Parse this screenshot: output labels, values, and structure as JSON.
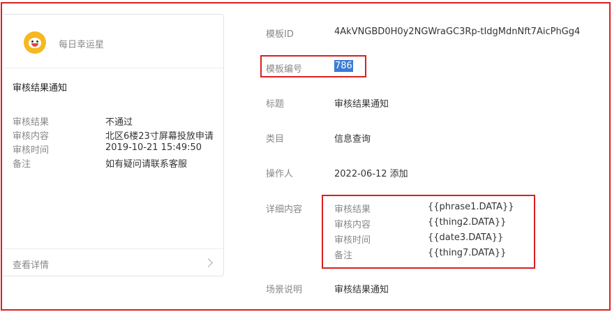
{
  "preview": {
    "account_name": "每日幸运星",
    "title": "审核结果通知",
    "rows": [
      {
        "key": "审核结果",
        "value": "不通过"
      },
      {
        "key": "审核内容",
        "value": "北区6楼23寸屏幕投放申请"
      },
      {
        "key": "审核时间",
        "value": "2019-10-21 15:49:50"
      },
      {
        "key": "备注",
        "value": "如有疑问请联系客服"
      }
    ],
    "view_detail": "查看详情"
  },
  "detail": {
    "template_id_label": "模板ID",
    "template_id": "4AkVNGBD0H0y2NGWraGC3Rp-tIdgMdnNft7AicPhGg4",
    "template_number_label": "模板编号",
    "template_number": "786",
    "title_label": "标题",
    "title": "审核结果通知",
    "category_label": "类目",
    "category": "信息查询",
    "operator_label": "操作人",
    "operator": "2022-06-12 添加",
    "content_label": "详细内容",
    "content_rows": [
      {
        "key": "审核结果",
        "value": "{{phrase1.DATA}}"
      },
      {
        "key": "审核内容",
        "value": "{{thing2.DATA}}"
      },
      {
        "key": "审核时间",
        "value": "{{date3.DATA}}"
      },
      {
        "key": "备注",
        "value": "{{thing7.DATA}}"
      }
    ],
    "scene_label": "场景说明",
    "scene": "审核结果通知"
  },
  "colors": {
    "annotation_red": "#d8201f",
    "selection_blue": "#3a7bd5"
  }
}
